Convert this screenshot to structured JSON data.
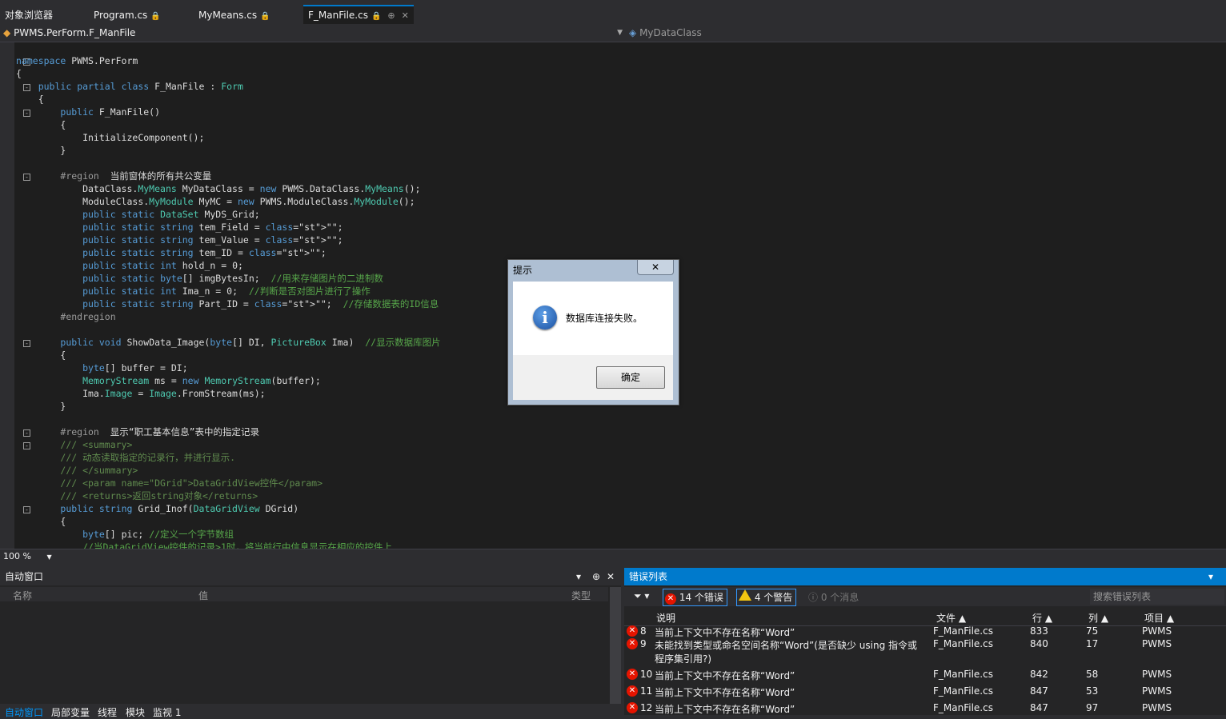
{
  "tabs": [
    {
      "label": "对象浏览器"
    },
    {
      "label": "Program.cs",
      "icon": "lock-icon"
    },
    {
      "label": "MyMeans.cs",
      "icon": "lock-icon"
    },
    {
      "label": "F_ManFile.cs",
      "icon": "lock-icon",
      "active": true,
      "pin": "⊕",
      "close": "✕"
    }
  ],
  "navbar": {
    "left": "PWMS.PerForm.F_ManFile",
    "right": "MyDataClass"
  },
  "code": [
    "namespace PWMS.PerForm",
    "{",
    "    public partial class F_ManFile : Form",
    "    {",
    "        public F_ManFile()",
    "        {",
    "            InitializeComponent();",
    "        }",
    "",
    "        #region  当前窗体的所有共公变量",
    "            DataClass.MyMeans MyDataClass = new PWMS.DataClass.MyMeans();",
    "            ModuleClass.MyModule MyMC = new PWMS.ModuleClass.MyModule();",
    "            public static DataSet MyDS_Grid;",
    "            public static string tem_Field = \"\";",
    "            public static string tem_Value = \"\";",
    "            public static string tem_ID = \"\";",
    "            public static int hold_n = 0;",
    "            public static byte[] imgBytesIn;  //用来存储图片的二进制数",
    "            public static int Ima_n = 0;  //判断是否对图片进行了操作",
    "            public static string Part_ID = \"\";  //存储数据表的ID信息",
    "        #endregion",
    "",
    "        public void ShowData_Image(byte[] DI, PictureBox Ima)  //显示数据库图片",
    "        {",
    "            byte[] buffer = DI;",
    "            MemoryStream ms = new MemoryStream(buffer);",
    "            Ima.Image = Image.FromStream(ms);",
    "        }",
    "",
    "        #region  显示“职工基本信息”表中的指定记录",
    "        /// <summary>",
    "        /// 动态读取指定的记录行，并进行显示.",
    "        /// </summary>",
    "        /// <param name=\"DGrid\">DataGridView控件</param>",
    "        /// <returns>返回string对象</returns>",
    "        public string Grid_Inof(DataGridView DGrid)",
    "        {",
    "            byte[] pic; //定义一个字节数组",
    "            //当DataGridView控件的记录>1时，将当前行中信息显示在相应的控件上"
  ],
  "zoom": "100 %",
  "autos": {
    "title": "自动窗口",
    "columns": {
      "name": "名称",
      "value": "值",
      "type": "类型"
    }
  },
  "bottom_tabs": [
    "自动窗口",
    "局部变量",
    "线程",
    "模块",
    "监视 1"
  ],
  "errorlist": {
    "title": "错误列表",
    "errors_btn": "14 个错误",
    "warnings_btn": "4 个警告",
    "messages_btn": "0 个消息",
    "search_placeholder": "搜索错误列表",
    "columns": {
      "desc": "说明",
      "file": "文件",
      "line": "行",
      "col": "列",
      "project": "项目"
    },
    "rows": [
      {
        "num": "8",
        "desc": "当前上下文中不存在名称“Word”",
        "file": "F_ManFile.cs",
        "line": "833",
        "col": "75",
        "project": "PWMS"
      },
      {
        "num": "9",
        "desc": "未能找到类型或命名空间名称“Word”(是否缺少 using 指令或",
        "desc2": "程序集引用?)",
        "file": "F_ManFile.cs",
        "line": "840",
        "col": "17",
        "project": "PWMS"
      },
      {
        "num": "10",
        "desc": "当前上下文中不存在名称“Word”",
        "file": "F_ManFile.cs",
        "line": "842",
        "col": "58",
        "project": "PWMS"
      },
      {
        "num": "11",
        "desc": "当前上下文中不存在名称“Word”",
        "file": "F_ManFile.cs",
        "line": "847",
        "col": "53",
        "project": "PWMS"
      },
      {
        "num": "12",
        "desc": "当前上下文中不存在名称“Word”",
        "file": "F_ManFile.cs",
        "line": "847",
        "col": "97",
        "project": "PWMS"
      }
    ]
  },
  "dialog": {
    "title": "提示",
    "message": "数据库连接失败。",
    "ok": "确定",
    "close": "✕",
    "icon": "info-icon"
  }
}
